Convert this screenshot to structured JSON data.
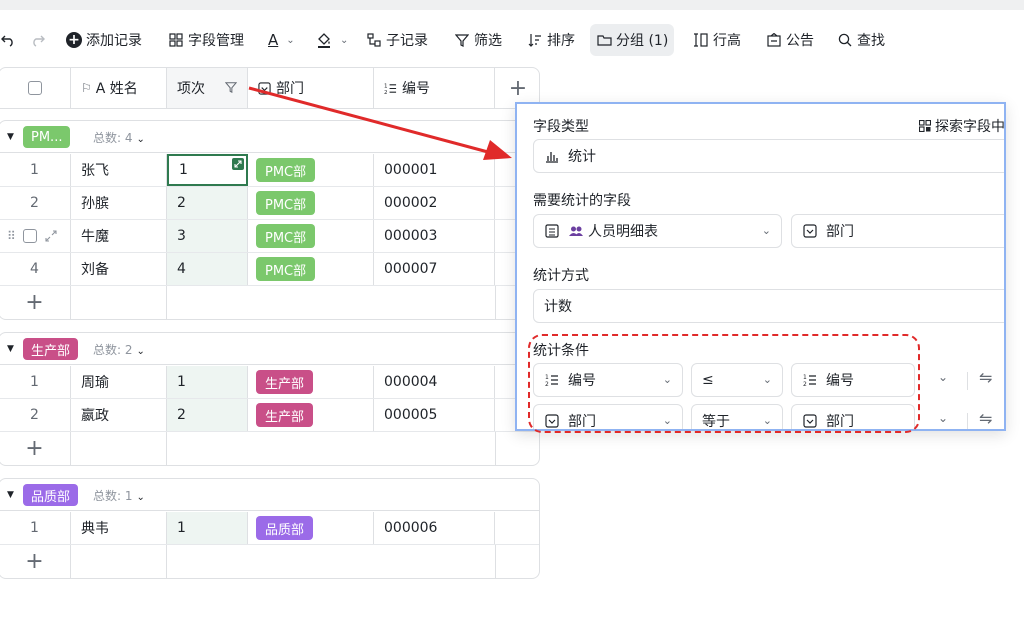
{
  "toolbar": {
    "add_record": "添加记录",
    "field_manage": "字段管理",
    "text_a": "A",
    "sub_record": "子记录",
    "filter": "筛选",
    "sort": "排序",
    "group": "分组 (1)",
    "row_height": "行高",
    "notice": "公告",
    "find": "查找"
  },
  "table": {
    "headers": {
      "name": "A 姓名",
      "xiangci": "项次",
      "dept": "部门",
      "code": "编号"
    },
    "groups": [
      {
        "tag": "PM...",
        "tag_color": "#7bc86c",
        "count_label": "总数: 4",
        "rows": [
          {
            "num": "1",
            "name": "张飞",
            "xiangci": "1",
            "dept": "PMC部",
            "code": "000001"
          },
          {
            "num": "2",
            "name": "孙膑",
            "xiangci": "2",
            "dept": "PMC部",
            "code": "000002"
          },
          {
            "num": "",
            "name": "牛魔",
            "xiangci": "3",
            "dept": "PMC部",
            "code": "000003"
          },
          {
            "num": "4",
            "name": "刘备",
            "xiangci": "4",
            "dept": "PMC部",
            "code": "000007"
          }
        ]
      },
      {
        "tag": "生产部",
        "tag_color": "#c94f88",
        "count_label": "总数: 2",
        "rows": [
          {
            "num": "1",
            "name": "周瑜",
            "xiangci": "1",
            "dept": "生产部",
            "code": "000004"
          },
          {
            "num": "2",
            "name": "嬴政",
            "xiangci": "2",
            "dept": "生产部",
            "code": "000005"
          }
        ]
      },
      {
        "tag": "品质部",
        "tag_color": "#9b6be8",
        "count_label": "总数: 1",
        "rows": [
          {
            "num": "1",
            "name": "典韦",
            "xiangci": "1",
            "dept": "品质部",
            "code": "000006"
          }
        ]
      }
    ]
  },
  "panel": {
    "field_type_label": "字段类型",
    "explore": "探索字段中",
    "field_type_value": "统计",
    "stat_field_label": "需要统计的字段",
    "stat_table": "人员明细表",
    "stat_field": "部门",
    "method_label": "统计方式",
    "method_value": "计数",
    "cond_label": "统计条件",
    "conditions": [
      {
        "left": "编号",
        "op": "≤",
        "right": "编号"
      },
      {
        "left": "部门",
        "op": "等于",
        "right": "部门"
      }
    ]
  },
  "colors": {
    "arrow": "#e02a2a",
    "panel_border": "#8fb3f2",
    "focus_green": "#2f7a4f"
  }
}
